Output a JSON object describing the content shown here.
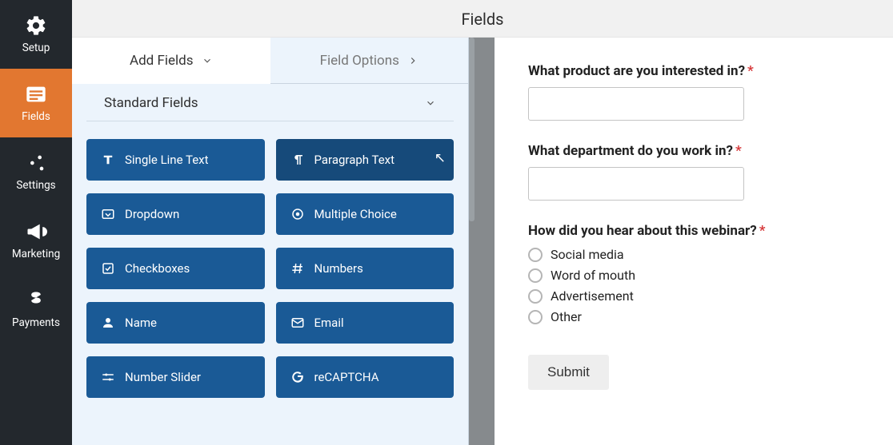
{
  "nav": {
    "items": [
      {
        "label": "Setup",
        "icon": "gear"
      },
      {
        "label": "Fields",
        "icon": "form",
        "active": true
      },
      {
        "label": "Settings",
        "icon": "sliders"
      },
      {
        "label": "Marketing",
        "icon": "bullhorn"
      },
      {
        "label": "Payments",
        "icon": "dollar"
      }
    ]
  },
  "header": {
    "title": "Fields"
  },
  "tabs": {
    "add": "Add Fields",
    "options": "Field Options"
  },
  "section": {
    "title": "Standard Fields"
  },
  "fields": {
    "single_line_text": "Single Line Text",
    "paragraph_text": "Paragraph Text",
    "dropdown": "Dropdown",
    "multiple_choice": "Multiple Choice",
    "checkboxes": "Checkboxes",
    "numbers": "Numbers",
    "name": "Name",
    "email": "Email",
    "number_slider": "Number Slider",
    "recaptcha": "reCAPTCHA"
  },
  "form": {
    "q1": {
      "label": "What product are you interested in?",
      "required": true
    },
    "q2": {
      "label": "What department do you work in?",
      "required": true
    },
    "q3": {
      "label": "How did you hear about this webinar?",
      "required": true,
      "options": [
        "Social media",
        "Word of mouth",
        "Advertisement",
        "Other"
      ]
    },
    "submit": "Submit"
  }
}
